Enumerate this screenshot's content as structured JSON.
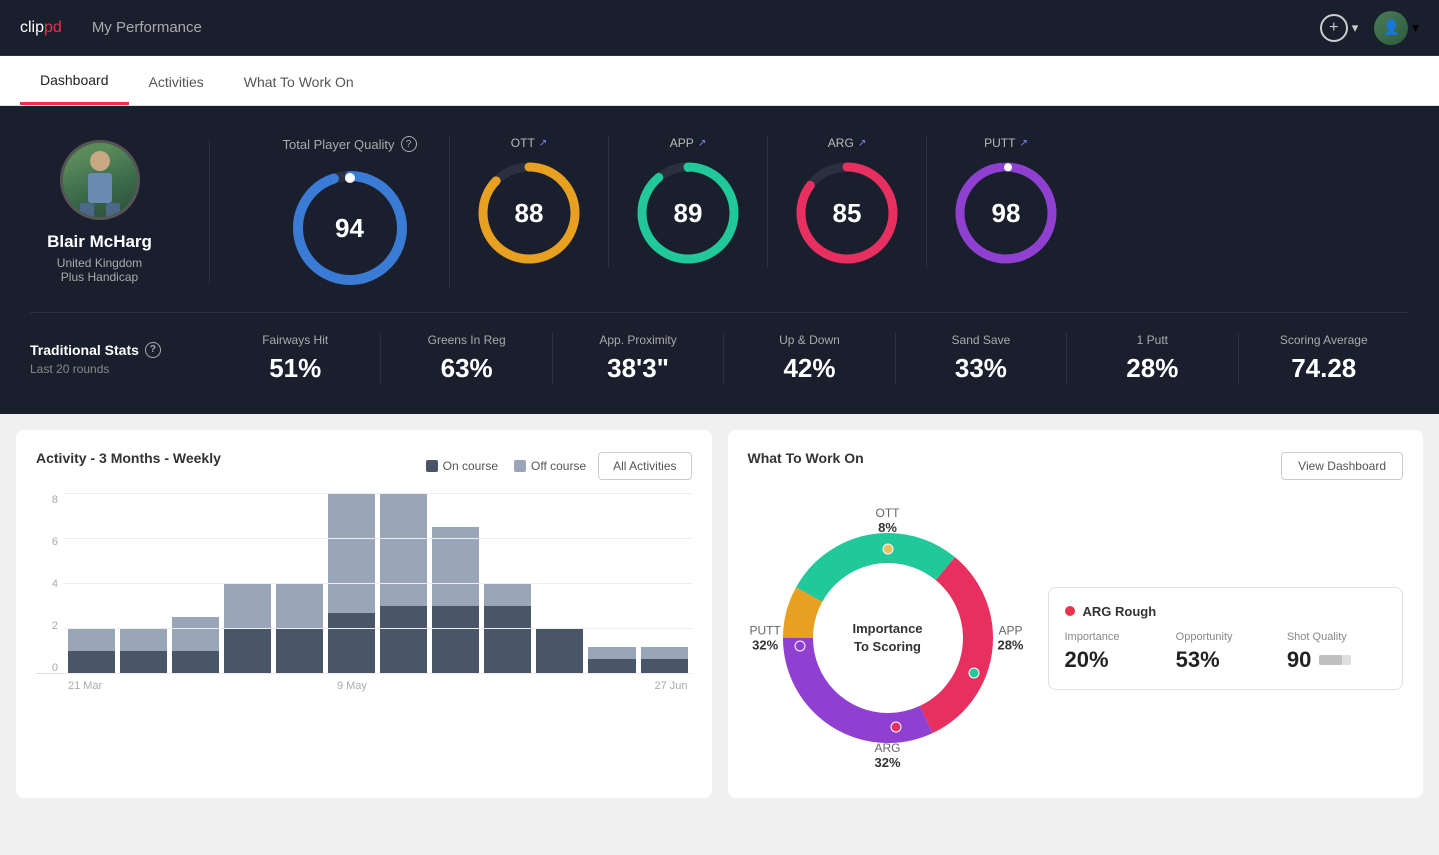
{
  "header": {
    "logo_clip": "clip",
    "logo_pd": "pd",
    "title": "My Performance",
    "add_label": "+",
    "chevron": "▾"
  },
  "nav": {
    "tabs": [
      {
        "id": "dashboard",
        "label": "Dashboard",
        "active": true
      },
      {
        "id": "activities",
        "label": "Activities",
        "active": false
      },
      {
        "id": "what-to-work-on",
        "label": "What To Work On",
        "active": false
      }
    ]
  },
  "player": {
    "name": "Blair McHarg",
    "country": "United Kingdom",
    "handicap": "Plus Handicap"
  },
  "total_quality": {
    "label": "Total Player Quality",
    "score": 94,
    "color": "#3a7bd5"
  },
  "category_scores": [
    {
      "id": "ott",
      "label": "OTT",
      "score": 88,
      "color": "#e8a020",
      "pct": 88
    },
    {
      "id": "app",
      "label": "APP",
      "score": 89,
      "color": "#20c89a",
      "pct": 89
    },
    {
      "id": "arg",
      "label": "ARG",
      "score": 85,
      "color": "#e83060",
      "pct": 85
    },
    {
      "id": "putt",
      "label": "PUTT",
      "score": 98,
      "color": "#9040d0",
      "pct": 98
    }
  ],
  "trad_stats": {
    "title": "Traditional Stats",
    "subtitle": "Last 20 rounds",
    "items": [
      {
        "name": "Fairways Hit",
        "value": "51%"
      },
      {
        "name": "Greens In Reg",
        "value": "63%"
      },
      {
        "name": "App. Proximity",
        "value": "38'3\""
      },
      {
        "name": "Up & Down",
        "value": "42%"
      },
      {
        "name": "Sand Save",
        "value": "33%"
      },
      {
        "name": "1 Putt",
        "value": "28%"
      },
      {
        "name": "Scoring Average",
        "value": "74.28"
      }
    ]
  },
  "activity_chart": {
    "title": "Activity - 3 Months - Weekly",
    "legend_on_course": "On course",
    "legend_off_course": "Off course",
    "btn_label": "All Activities",
    "y_labels": [
      "0",
      "2",
      "4",
      "6",
      "8"
    ],
    "x_labels": [
      "21 Mar",
      "",
      "9 May",
      "",
      "27 Jun"
    ],
    "color_on": "#4a5568",
    "color_off": "#9aa5b8",
    "bars": [
      {
        "on": 1,
        "off": 1
      },
      {
        "on": 1,
        "off": 1
      },
      {
        "on": 1,
        "off": 1.5
      },
      {
        "on": 2,
        "off": 2
      },
      {
        "on": 2,
        "off": 2
      },
      {
        "on": 3,
        "off": 6
      },
      {
        "on": 3,
        "off": 5
      },
      {
        "on": 2,
        "off": 3.5
      },
      {
        "on": 3,
        "off": 1
      },
      {
        "on": 2,
        "off": 0
      },
      {
        "on": 0.5,
        "off": 0.3
      },
      {
        "on": 0.5,
        "off": 0.3
      }
    ]
  },
  "what_to_work_on": {
    "title": "What To Work On",
    "btn_label": "View Dashboard",
    "donut_center_line1": "Importance",
    "donut_center_line2": "To Scoring",
    "segments": [
      {
        "id": "ott",
        "label": "OTT",
        "pct": 8,
        "color": "#e8a020"
      },
      {
        "id": "app",
        "label": "APP",
        "pct": 28,
        "color": "#20c89a"
      },
      {
        "id": "arg",
        "label": "ARG",
        "pct": 32,
        "color": "#e83060"
      },
      {
        "id": "putt",
        "label": "PUTT",
        "pct": 32,
        "color": "#9040d0"
      }
    ],
    "card": {
      "title": "ARG Rough",
      "importance": "20%",
      "opportunity": "53%",
      "shot_quality": "90",
      "importance_label": "Importance",
      "opportunity_label": "Opportunity",
      "shot_quality_label": "Shot Quality"
    }
  }
}
